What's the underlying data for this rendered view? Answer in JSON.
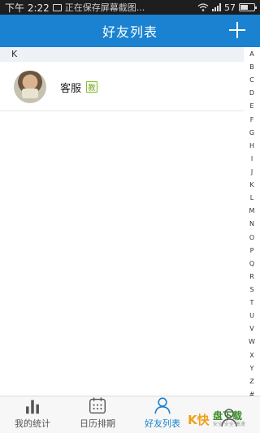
{
  "status_bar": {
    "time": "下午 2:22",
    "toast": "正在保存屏幕截图...",
    "battery": "57",
    "battery_level": 0.57
  },
  "title_bar": {
    "title": "好友列表",
    "add_icon": "plus-icon"
  },
  "section": {
    "header": "K"
  },
  "contacts": [
    {
      "name": "客服",
      "badge": "教"
    }
  ],
  "index_letters": [
    "A",
    "B",
    "C",
    "D",
    "E",
    "F",
    "G",
    "H",
    "I",
    "J",
    "K",
    "L",
    "M",
    "N",
    "O",
    "P",
    "Q",
    "R",
    "S",
    "T",
    "U",
    "V",
    "W",
    "X",
    "Y",
    "Z",
    "#"
  ],
  "bottom_nav": {
    "items": [
      {
        "label": "我的统计",
        "icon": "bar-chart-icon"
      },
      {
        "label": "日历排期",
        "icon": "calendar-icon"
      },
      {
        "label": "好友列表",
        "icon": "person-icon",
        "active": true
      },
      {
        "label": "",
        "icon": "people-icon"
      }
    ]
  },
  "watermark": {
    "logo": "K快",
    "main": "盘下载",
    "sub": "安全·安全·高速"
  },
  "colors": {
    "accent": "#1a82d0",
    "badge": "#7aa830"
  }
}
